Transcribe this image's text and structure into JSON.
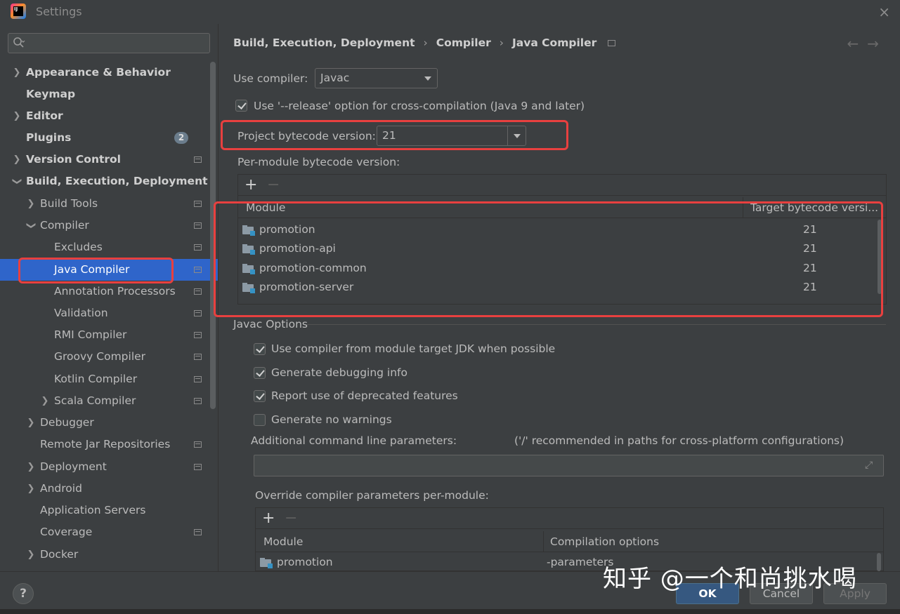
{
  "window": {
    "title": "Settings",
    "close": "×"
  },
  "search": {
    "placeholder": ""
  },
  "sidebar": {
    "items": [
      {
        "label": "Appearance & Behavior"
      },
      {
        "label": "Keymap"
      },
      {
        "label": "Editor"
      },
      {
        "label": "Plugins",
        "badge": "2"
      },
      {
        "label": "Version Control"
      },
      {
        "label": "Build, Execution, Deployment"
      },
      {
        "label": "Build Tools"
      },
      {
        "label": "Compiler"
      },
      {
        "label": "Excludes"
      },
      {
        "label": "Java Compiler"
      },
      {
        "label": "Annotation Processors"
      },
      {
        "label": "Validation"
      },
      {
        "label": "RMI Compiler"
      },
      {
        "label": "Groovy Compiler"
      },
      {
        "label": "Kotlin Compiler"
      },
      {
        "label": "Scala Compiler"
      },
      {
        "label": "Debugger"
      },
      {
        "label": "Remote Jar Repositories"
      },
      {
        "label": "Deployment"
      },
      {
        "label": "Android"
      },
      {
        "label": "Application Servers"
      },
      {
        "label": "Coverage"
      },
      {
        "label": "Docker"
      }
    ]
  },
  "breadcrumb": {
    "items": [
      "Build, Execution, Deployment",
      "Compiler",
      "Java Compiler"
    ],
    "sep": "›",
    "back": "←",
    "forward": "→"
  },
  "compiler": {
    "use_compiler_label": "Use compiler:",
    "use_compiler_value": "Javac",
    "release_option_label": "Use '--release' option for cross-compilation (Java 9 and later)",
    "project_bytecode_label": "Project bytecode version:",
    "project_bytecode_value": "21",
    "per_module_label": "Per-module bytecode version:"
  },
  "module_table": {
    "add": "+",
    "remove": "−",
    "headers": [
      "Module",
      "Target bytecode versi..."
    ],
    "rows": [
      {
        "module": "promotion",
        "target": "21"
      },
      {
        "module": "promotion-api",
        "target": "21"
      },
      {
        "module": "promotion-common",
        "target": "21"
      },
      {
        "module": "promotion-server",
        "target": "21"
      }
    ]
  },
  "javac_options": {
    "title": "Javac Options",
    "checkboxes": [
      {
        "label": "Use compiler from module target JDK when possible",
        "checked": true
      },
      {
        "label": "Generate debugging info",
        "checked": true
      },
      {
        "label": "Report use of deprecated features",
        "checked": true
      },
      {
        "label": "Generate no warnings",
        "checked": false
      }
    ],
    "additional_params_label": "Additional command line parameters:",
    "additional_params_hint": "('/' recommended in paths for cross-platform configurations)",
    "additional_params_value": "",
    "override_label": "Override compiler parameters per-module:"
  },
  "override_table": {
    "add": "+",
    "remove": "−",
    "headers": [
      "Module",
      "Compilation options"
    ],
    "rows": [
      {
        "module": "promotion",
        "options": "-parameters"
      }
    ]
  },
  "buttons": {
    "help": "?",
    "ok": "OK",
    "cancel": "Cancel",
    "apply": "Apply"
  },
  "watermark": "知乎 @一个和尚挑水喝",
  "colors": {
    "background": "#3c3f41",
    "selection": "#2f65ca",
    "highlight_box": "#e8403f",
    "primary_button": "#365880"
  }
}
